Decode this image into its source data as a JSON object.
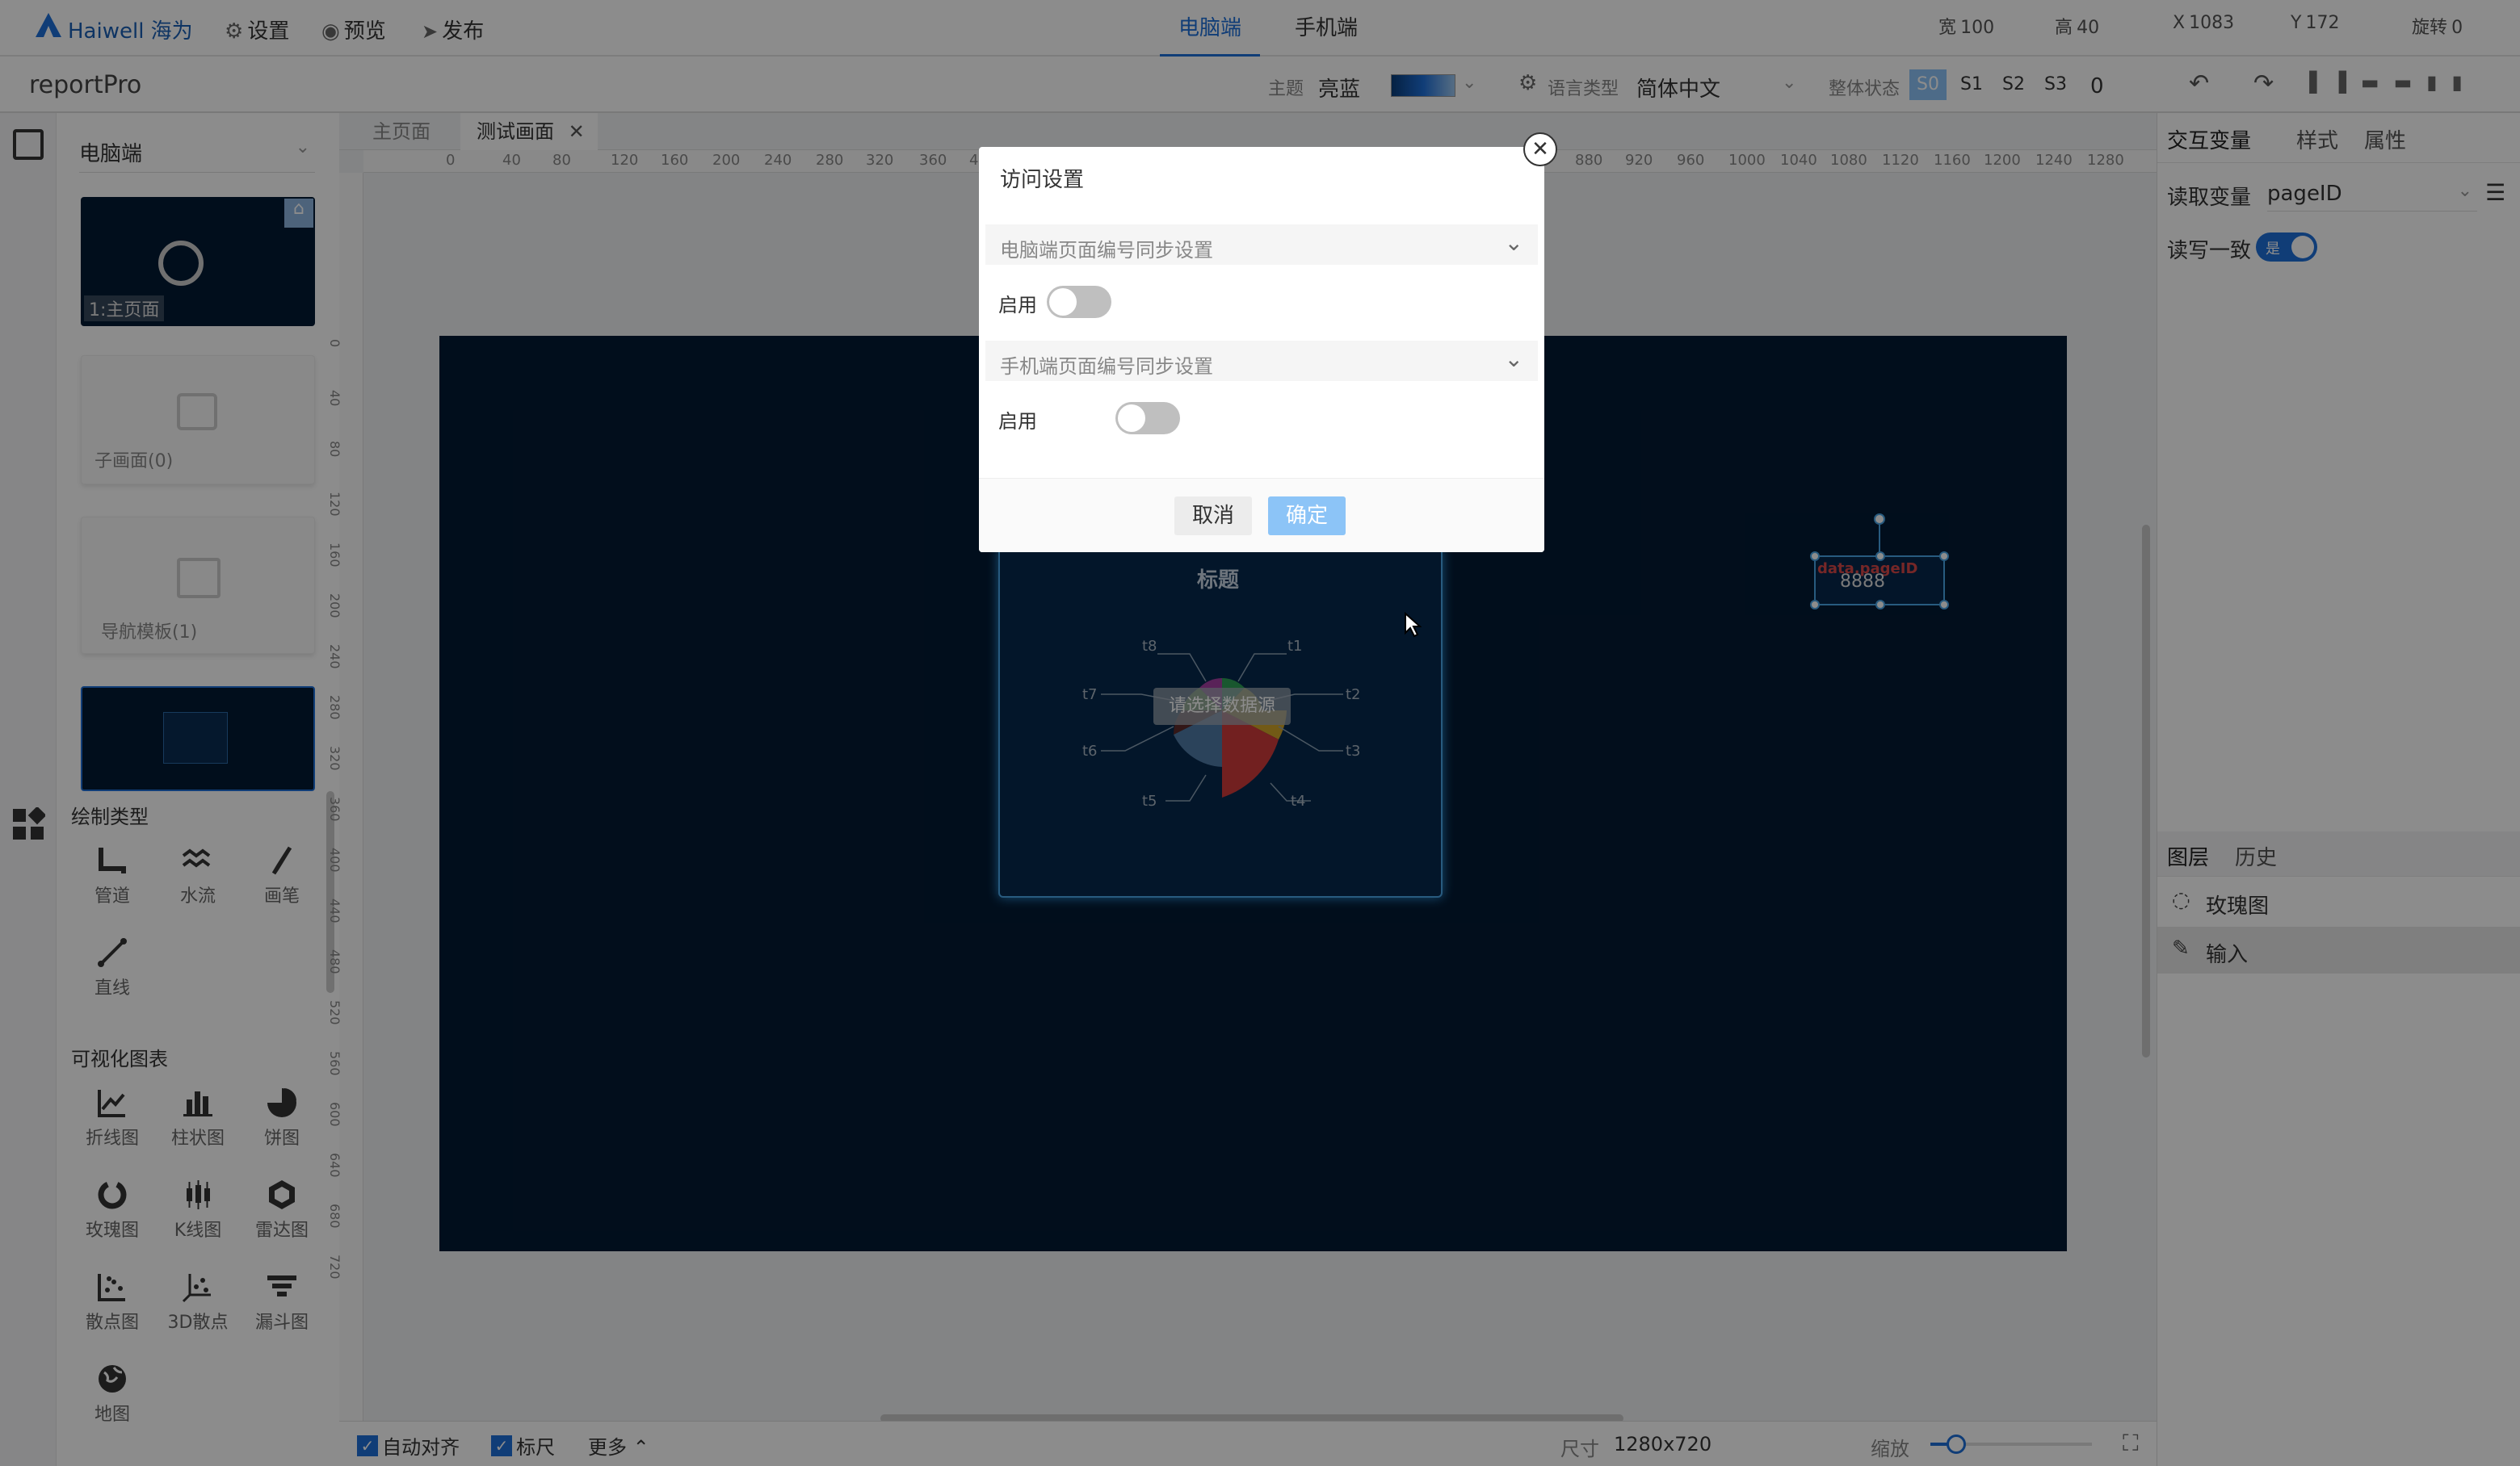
{
  "topbar": {
    "logo": "Haiwell 海为",
    "settings": "设置",
    "preview": "预览",
    "publish": "发布",
    "tab_pc": "电脑端",
    "tab_mobile": "手机端",
    "fields": [
      {
        "label": "宽",
        "value": "100"
      },
      {
        "label": "高",
        "value": "40"
      },
      {
        "label": "X",
        "value": "1083"
      },
      {
        "label": "Y",
        "value": "172"
      },
      {
        "label": "旋转",
        "value": "0"
      }
    ]
  },
  "toolbar2": {
    "project": "reportPro",
    "theme_label": "主题",
    "theme_value": "亮蓝",
    "lang_label": "语言类型",
    "lang_value": "简体中文",
    "state_label": "整体状态",
    "states": [
      "S0",
      "S1",
      "S2",
      "S3"
    ],
    "state_num": "0"
  },
  "left": {
    "device_select": "电脑端",
    "thumbs": [
      "1:主页面",
      "子画面(0)",
      "导航模板(1)"
    ],
    "section_draw": "绘制类型",
    "draw_items": [
      "管道",
      "水流",
      "画笔",
      "直线"
    ],
    "section_chart": "可视化图表",
    "chart_items": [
      "折线图",
      "柱状图",
      "饼图",
      "玫瑰图",
      "K线图",
      "雷达图",
      "散点图",
      "3D散点",
      "漏斗图",
      "地图"
    ]
  },
  "editor": {
    "tabs": [
      "主页面",
      "测试画面"
    ],
    "ruler_h": [
      "0",
      "40",
      "80",
      "120",
      "160",
      "200",
      "240",
      "280",
      "320",
      "360",
      "400",
      "880",
      "920",
      "960",
      "1000",
      "1040",
      "1080",
      "1120",
      "1160",
      "1200",
      "1240",
      "1280"
    ],
    "ruler_v": [
      "0",
      "40",
      "80",
      "120",
      "160",
      "200",
      "240",
      "280",
      "320",
      "360",
      "400",
      "440",
      "480",
      "520",
      "560",
      "600",
      "640",
      "680",
      "720"
    ],
    "chart_title": "标题",
    "chart_placeholder": "请选择数据源",
    "chart_labels": [
      "t1",
      "t2",
      "t3",
      "t4",
      "t5",
      "t6",
      "t7",
      "t8"
    ],
    "input_text": "data.pageID",
    "input_value": "8888"
  },
  "bottom": {
    "auto_align": "自动对齐",
    "ruler": "标尺",
    "more": "更多",
    "size_label": "尺寸",
    "size_value": "1280x720",
    "zoom_label": "缩放"
  },
  "right": {
    "tabs": [
      "交互变量",
      "样式",
      "属性"
    ],
    "read_var_label": "读取变量",
    "read_var_value": "pageID",
    "rw_label": "读写一致",
    "rw_toggle": "是",
    "layer_tabs": [
      "图层",
      "历史"
    ],
    "layers": [
      "玫瑰图",
      "输入"
    ]
  },
  "modal": {
    "title": "访问设置",
    "section_pc": "电脑端页面编号同步设置",
    "section_mobile": "手机端页面编号同步设置",
    "enable": "启用",
    "cancel": "取消",
    "confirm": "确定"
  },
  "colors": {
    "accent": "#1e6fd9",
    "stage": "#031a33",
    "confirm": "#8cc4f7"
  }
}
